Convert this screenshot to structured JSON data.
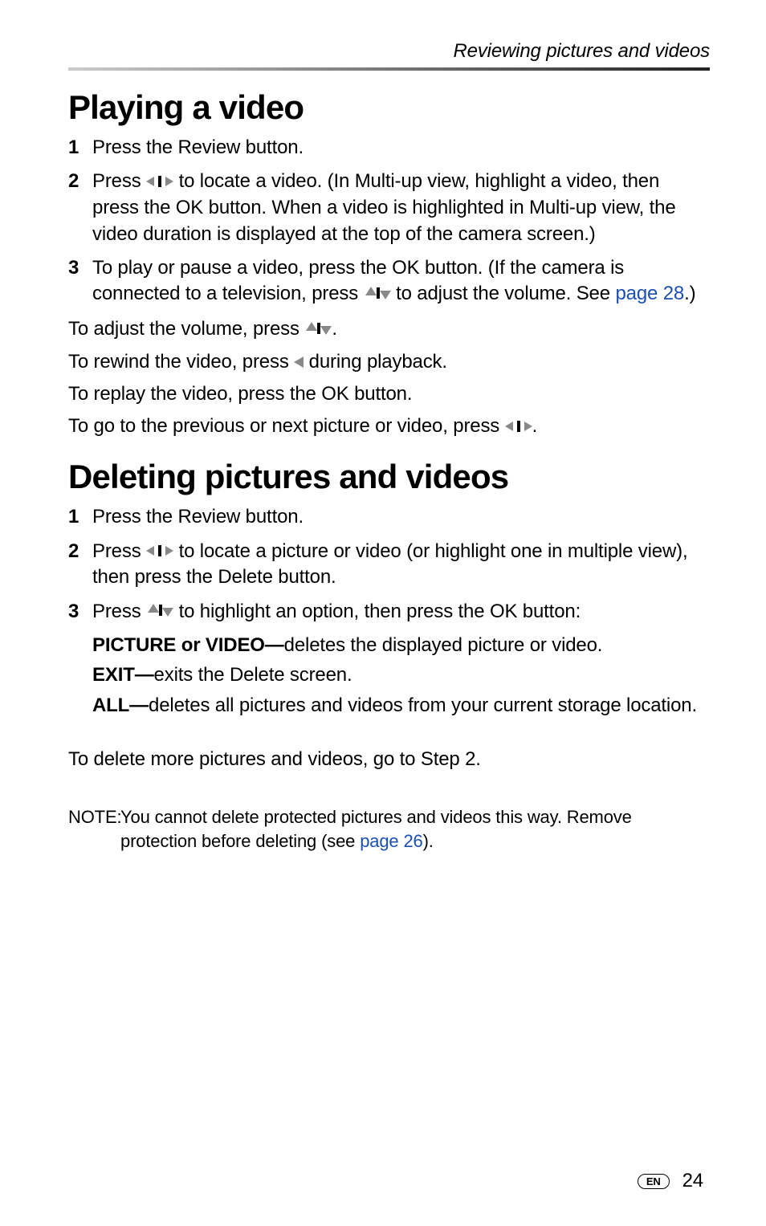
{
  "header": {
    "running": "Reviewing pictures and videos"
  },
  "sectionA": {
    "title": "Playing a video",
    "steps": [
      "Press the Review button.",
      "Press LR to locate a video. (In Multi-up view, highlight a video, then press the OK button. When a video is highlighted in Multi-up view, the video duration is displayed at the top of the camera screen.)",
      "To play or pause a video, press the OK button. (If the camera is connected to a television, press UD to adjust the volume. See LINK1.)"
    ],
    "link1": "page 28",
    "lines": [
      "To adjust the volume, press UD.",
      "To rewind the video, press L during playback.",
      "To replay the video, press the OK button.",
      "To go to the previous or next picture or video, press LR."
    ]
  },
  "sectionB": {
    "title": "Deleting pictures and videos",
    "steps": [
      "Press the Review button.",
      "Press LR to locate a picture or video (or highlight one in multiple view), then press the Delete button.",
      "Press UD to highlight an option, then press the OK button:"
    ],
    "subs": [
      {
        "label": "PICTURE or VIDEO—",
        "text": "deletes the displayed picture or video."
      },
      {
        "label": "EXIT—",
        "text": "exits the Delete screen."
      },
      {
        "label": "ALL—",
        "text": "deletes all pictures and videos from your current storage location."
      }
    ],
    "after": "To delete more pictures and videos, go to Step 2.",
    "noteLabel": "NOTE:",
    "noteBody": "You cannot delete protected pictures and videos this way. Remove protection before deleting (see LINK2).",
    "link2": "page 26"
  },
  "footer": {
    "lang": "EN",
    "page": "24"
  }
}
